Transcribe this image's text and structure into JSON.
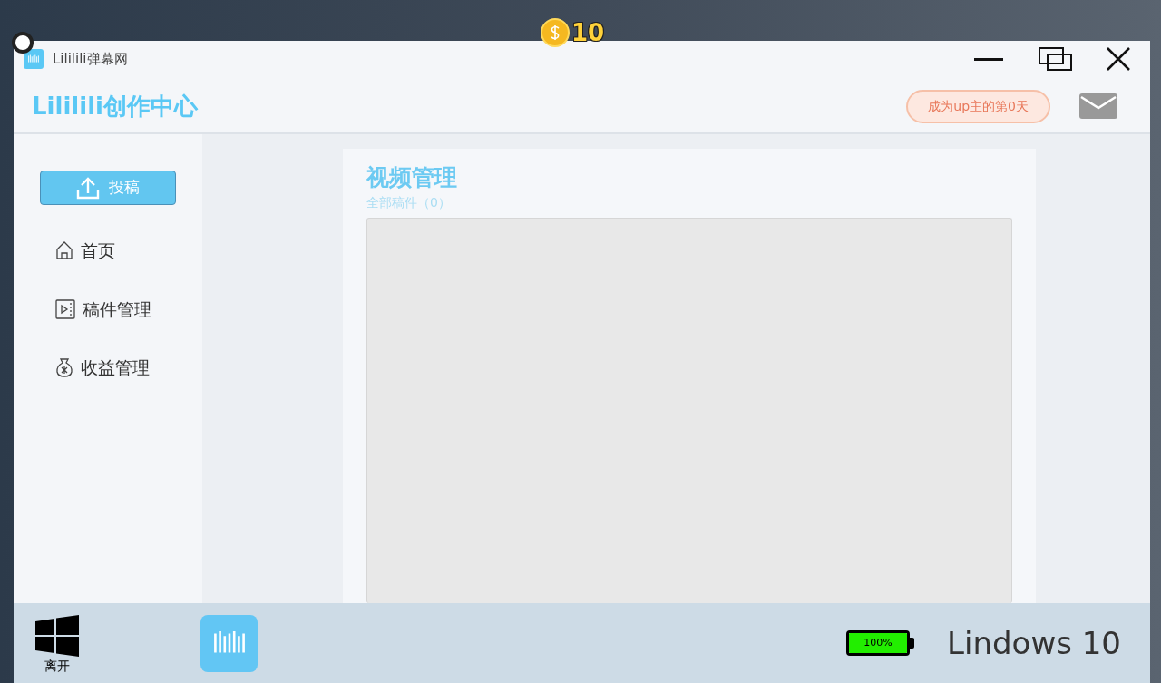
{
  "coins": "10",
  "window": {
    "title": "Lililili弹幕网"
  },
  "header": {
    "brand": "Lililili创作中心",
    "badge": "成为up主的第0天"
  },
  "sidebar": {
    "upload": "投稿",
    "items": [
      {
        "label": "首页",
        "kind": "home",
        "selected": false
      },
      {
        "label": "稿件管理",
        "kind": "video",
        "selected": false
      },
      {
        "label": "收益管理",
        "kind": "money",
        "selected": false
      }
    ]
  },
  "main": {
    "title": "视频管理",
    "subtitle": "全部稿件（0）"
  },
  "taskbar": {
    "start_label": "离开",
    "battery": {
      "level": 1,
      "reading": "100%"
    },
    "os_name": "Lindows 10"
  }
}
